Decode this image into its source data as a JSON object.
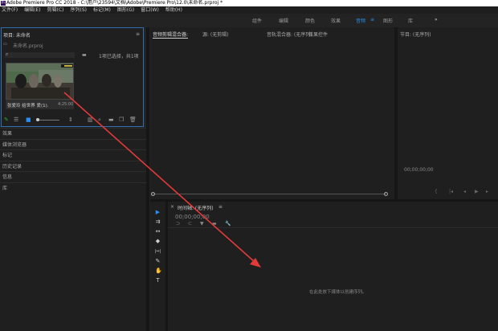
{
  "window": {
    "title": "Adobe Premiere Pro CC 2018 - C:\\用户\\23594\\文档\\Adobe\\Premiere Pro\\12.0\\未命名.prproj *",
    "icon": "Pr"
  },
  "menu": [
    "文件(F)",
    "编辑(E)",
    "剪辑(C)",
    "序列(S)",
    "标记(M)",
    "图形(G)",
    "窗口(W)",
    "帮助(H)"
  ],
  "workspaces": {
    "items": [
      "组件",
      "编辑",
      "颜色",
      "效果",
      "音频",
      "图形",
      "库"
    ],
    "active_index": 4,
    "more": "»"
  },
  "project": {
    "title": "项目: 未命名",
    "menu_icon": "≡",
    "file": "未命名.prproj",
    "selection": "1项已选择，共1项",
    "search_placeholder": "",
    "clip_name": "张爱玲 给世界 爱(1).",
    "clip_duration": "4:25:00",
    "badge": "▦"
  },
  "side_panels": [
    "效果",
    "媒体浏览器",
    "标记",
    "历史记录",
    "信息",
    "库"
  ],
  "source_tabs": [
    "音频剪辑混合器:",
    "源: (无剪辑)",
    "音轨混合器: (无序列)",
    "效果控件"
  ],
  "source_tab_menu": "≡",
  "program": {
    "title": "节目: (无序列)",
    "timecode": "00;00;00;00"
  },
  "timeline": {
    "title": "时间轴: (无序列)",
    "timecode": "00;00;00;00",
    "hint": "在此处放下媒体以创建序列。",
    "close": "×"
  },
  "tools": [
    "▶",
    "⇉",
    "↔",
    "◆",
    "|↔|",
    "✎",
    "✋",
    "T"
  ],
  "colors": {
    "accent": "#2d8ceb",
    "arrow": "#e23a3a"
  }
}
